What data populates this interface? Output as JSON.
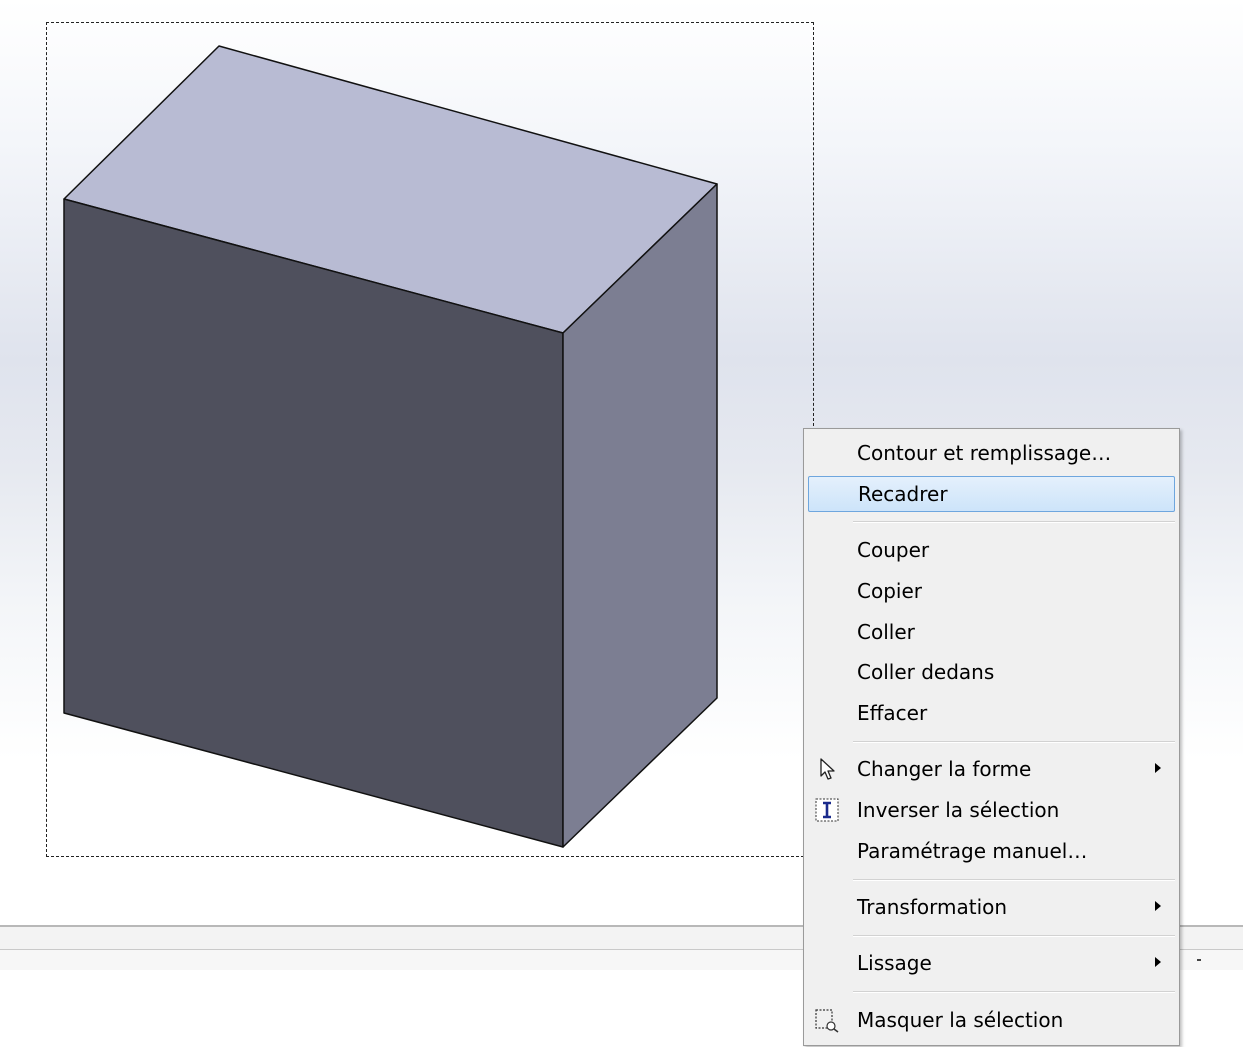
{
  "context_menu": {
    "items": [
      {
        "label": "Contour et remplissage…",
        "submenu": false
      },
      {
        "label": "Recadrer",
        "submenu": false,
        "highlighted": true
      },
      {
        "label": "Couper",
        "submenu": false
      },
      {
        "label": "Copier",
        "submenu": false
      },
      {
        "label": "Coller",
        "submenu": false
      },
      {
        "label": "Coller dedans",
        "submenu": false
      },
      {
        "label": "Effacer",
        "submenu": false
      },
      {
        "label": "Changer la forme",
        "submenu": true,
        "icon": "pointer-arrow-icon"
      },
      {
        "label": "Inverser la sélection",
        "submenu": false,
        "icon": "text-cursor-icon"
      },
      {
        "label": "Paramétrage manuel…",
        "submenu": false
      },
      {
        "label": "Transformation",
        "submenu": true
      },
      {
        "label": "Lissage",
        "submenu": true
      },
      {
        "label": "Masquer la sélection",
        "submenu": false,
        "icon": "hide-selection-icon"
      }
    ]
  },
  "object": {
    "type": "3d-box",
    "colors": {
      "top_face": "#b8bbd3",
      "front_face": "#4f505d",
      "side_face": "#7c7e92",
      "outline": "#111111"
    }
  },
  "colors": {
    "menu_background": "#f0f0f0",
    "highlight_border": "#6ea6de",
    "highlight_fill": "#cde4fa"
  }
}
